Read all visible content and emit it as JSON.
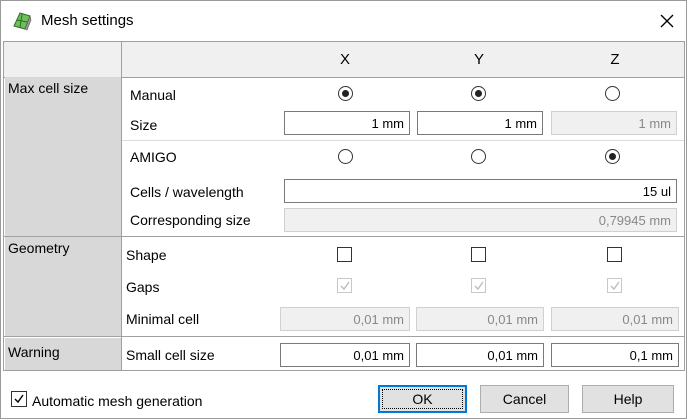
{
  "window": {
    "title": "Mesh settings",
    "app_icon": "mesh-app-icon",
    "close_icon": "close-icon"
  },
  "columns": [
    "X",
    "Y",
    "Z"
  ],
  "groups": {
    "max_cell_size": "Max cell size",
    "geometry": "Geometry",
    "warning": "Warning"
  },
  "rows": {
    "manual": {
      "label": "Manual",
      "selected": [
        true,
        true,
        false
      ]
    },
    "size": {
      "label": "Size",
      "values": [
        "1 mm",
        "1 mm",
        "1 mm"
      ],
      "enabled": [
        true,
        true,
        false
      ]
    },
    "amigo": {
      "label": "AMIGO",
      "selected": [
        false,
        false,
        true
      ]
    },
    "cells_per_wavelength": {
      "label": "Cells / wavelength",
      "value": "15 ul"
    },
    "corresponding_size": {
      "label": "Corresponding size",
      "value": "0,79945 mm"
    },
    "shape": {
      "label": "Shape",
      "checked": [
        false,
        false,
        false
      ]
    },
    "gaps": {
      "label": "Gaps",
      "checked": [
        true,
        true,
        true
      ],
      "enabled": false
    },
    "minimal_cell": {
      "label": "Minimal cell",
      "values": [
        "0,01 mm",
        "0,01 mm",
        "0,01 mm"
      ]
    },
    "small_cell_size": {
      "label": "Small cell size",
      "values": [
        "0,01 mm",
        "0,01 mm",
        "0,1 mm"
      ]
    }
  },
  "footer": {
    "automatic_mesh_generation": {
      "label": "Automatic mesh generation",
      "checked": true
    },
    "ok": "OK",
    "cancel": "Cancel",
    "help": "Help"
  },
  "colors": {
    "header_bg": "#f0f0f0",
    "group_bg": "#d8d8d8",
    "default_button_border": "#0078d7",
    "disabled_field_bg": "#f0f0f0"
  }
}
